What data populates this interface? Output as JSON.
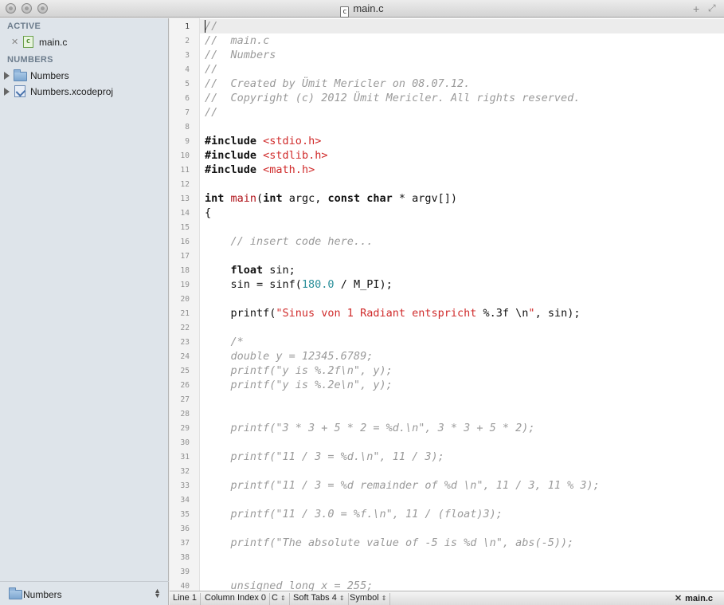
{
  "window": {
    "title": "main.c"
  },
  "sidebar": {
    "active_header": "ACTIVE",
    "open_file": "main.c",
    "project_header": "NUMBERS",
    "items": [
      "Numbers",
      "Numbers.xcodeproj"
    ],
    "footer_label": "Numbers"
  },
  "editor": {
    "current_line": 1,
    "lines": [
      {
        "n": "1",
        "c": "cm",
        "t": "//"
      },
      {
        "n": "2",
        "c": "cm",
        "t": "//  main.c"
      },
      {
        "n": "3",
        "c": "cm",
        "t": "//  Numbers"
      },
      {
        "n": "4",
        "c": "cm",
        "t": "//"
      },
      {
        "n": "5",
        "c": "cm",
        "t": "//  Created by Ümit Mericler on 08.07.12."
      },
      {
        "n": "6",
        "c": "cm",
        "t": "//  Copyright (c) 2012 Ümit Mericler. All rights reserved."
      },
      {
        "n": "7",
        "c": "cm",
        "t": "//"
      },
      {
        "n": "8",
        "c": "",
        "t": ""
      },
      {
        "n": "9",
        "c": "inc",
        "t": "#include",
        "s": "<stdio.h>"
      },
      {
        "n": "10",
        "c": "inc",
        "t": "#include",
        "s": "<stdlib.h>"
      },
      {
        "n": "11",
        "c": "inc",
        "t": "#include",
        "s": "<math.h>"
      },
      {
        "n": "12",
        "c": "",
        "t": ""
      },
      {
        "n": "13",
        "c": "main",
        "t": "int main(int argc, const char * argv[])"
      },
      {
        "n": "14",
        "c": "",
        "t": "{"
      },
      {
        "n": "15",
        "c": "",
        "t": ""
      },
      {
        "n": "16",
        "c": "cm",
        "t": "    // insert code here..."
      },
      {
        "n": "17",
        "c": "",
        "t": ""
      },
      {
        "n": "18",
        "c": "float",
        "t": "    float sin;"
      },
      {
        "n": "19",
        "c": "sinf",
        "t": "    sin = sinf(180.0 / M_PI);"
      },
      {
        "n": "20",
        "c": "",
        "t": ""
      },
      {
        "n": "21",
        "c": "printf",
        "t": "    printf(\"Sinus von 1 Radiant entspricht %.3f \\n\", sin);"
      },
      {
        "n": "22",
        "c": "",
        "t": ""
      },
      {
        "n": "23",
        "c": "cm",
        "t": "    /*"
      },
      {
        "n": "24",
        "c": "cm",
        "t": "    double y = 12345.6789;"
      },
      {
        "n": "25",
        "c": "cm",
        "t": "    printf(\"y is %.2f\\n\", y);"
      },
      {
        "n": "26",
        "c": "cm",
        "t": "    printf(\"y is %.2e\\n\", y);"
      },
      {
        "n": "27",
        "c": "",
        "t": ""
      },
      {
        "n": "28",
        "c": "",
        "t": ""
      },
      {
        "n": "29",
        "c": "cm",
        "t": "    printf(\"3 * 3 + 5 * 2 = %d.\\n\", 3 * 3 + 5 * 2);"
      },
      {
        "n": "30",
        "c": "",
        "t": ""
      },
      {
        "n": "31",
        "c": "cm",
        "t": "    printf(\"11 / 3 = %d.\\n\", 11 / 3);"
      },
      {
        "n": "32",
        "c": "",
        "t": ""
      },
      {
        "n": "33",
        "c": "cm",
        "t": "    printf(\"11 / 3 = %d remainder of %d \\n\", 11 / 3, 11 % 3);"
      },
      {
        "n": "34",
        "c": "",
        "t": ""
      },
      {
        "n": "35",
        "c": "cm",
        "t": "    printf(\"11 / 3.0 = %f.\\n\", 11 / (float)3);"
      },
      {
        "n": "36",
        "c": "",
        "t": ""
      },
      {
        "n": "37",
        "c": "cm",
        "t": "    printf(\"The absolute value of -5 is %d \\n\", abs(-5));"
      },
      {
        "n": "38",
        "c": "",
        "t": ""
      },
      {
        "n": "39",
        "c": "",
        "t": ""
      },
      {
        "n": "40",
        "c": "cm",
        "t": "    unsigned long x = 255;"
      }
    ]
  },
  "statusbar": {
    "line": "Line 1",
    "column": "Column Index 0",
    "syntax": "C",
    "tabs": "Soft Tabs 4",
    "symbol": "Symbol",
    "file": "main.c"
  }
}
